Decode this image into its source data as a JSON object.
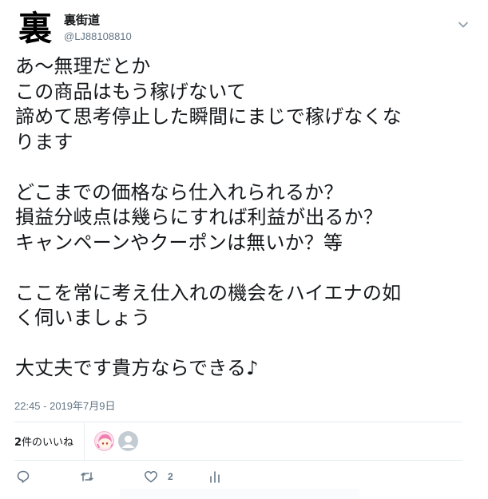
{
  "author": {
    "avatar_glyph": "裏",
    "name": "裏街道",
    "handle": "@LJ88108810"
  },
  "tweet": {
    "text": "あ〜無理だとか\nこの商品はもう稼げないて\n諦めて思考停止した瞬間にまじで稼げなくな\nります\n\nどこまでの価格なら仕入れられるか？\n損益分岐点は幾らにすれば利益が出るか？\nキャンペーンやクーポンは無いか？等\n\nここを常に考え仕入れの機会をハイエナの如\nく伺いましょう\n\n大丈夫です貴方ならできる♪",
    "timestamp": "22:45 - 2019年7月9日"
  },
  "likes": {
    "count": "2",
    "label_suffix": "件のいいね"
  },
  "actions": {
    "like_count": "2"
  },
  "colors": {
    "text": "#14171a",
    "secondary": "#657786",
    "divider": "#e6ecf0"
  }
}
